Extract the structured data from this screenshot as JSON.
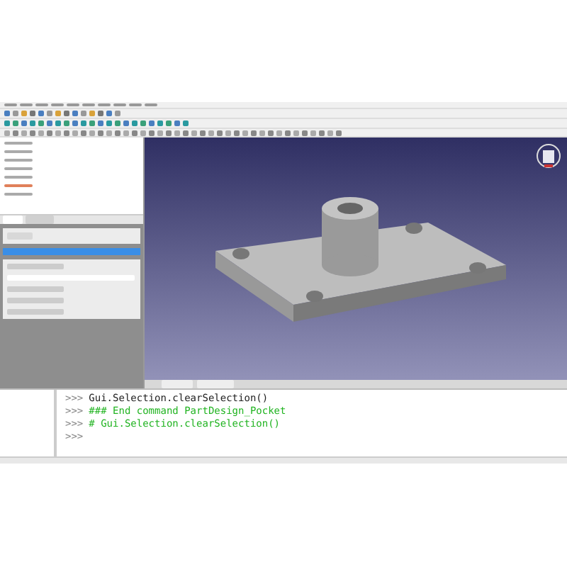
{
  "console": {
    "lines": [
      {
        "prompt": ">>>",
        "text": "Gui.Selection.clearSelection()",
        "kind": "command"
      },
      {
        "prompt": ">>>",
        "text": "### End command PartDesign_Pocket",
        "kind": "comment"
      },
      {
        "prompt": ">>>",
        "text": "# Gui.Selection.clearSelection()",
        "kind": "comment"
      },
      {
        "prompt": ">>>",
        "kind": "command"
      }
    ]
  }
}
